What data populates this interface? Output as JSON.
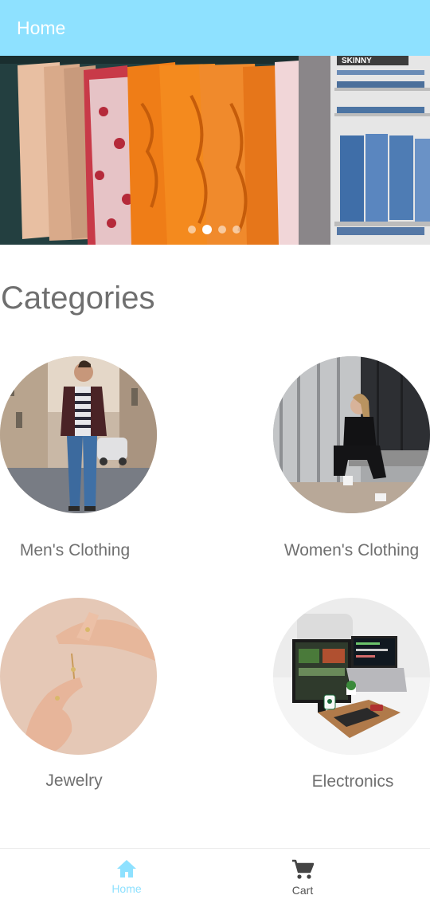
{
  "appbar": {
    "title": "Home"
  },
  "carousel": {
    "slides": [
      "clothing-rack-photo",
      "jeans-shelf-photo"
    ],
    "active_index": 1,
    "dot_count": 4
  },
  "categories": {
    "title": "Categories",
    "items": [
      {
        "label": "Men's Clothing",
        "image": "man-walking-photo"
      },
      {
        "label": "Women's Clothing",
        "image": "woman-sitting-photo"
      },
      {
        "label": "Jewelry",
        "image": "hands-ring-photo"
      },
      {
        "label": "Electronics",
        "image": "desk-computer-photo"
      }
    ]
  },
  "bottom_nav": {
    "items": [
      {
        "label": "Home",
        "icon": "home-icon",
        "active": true
      },
      {
        "label": "Cart",
        "icon": "cart-icon",
        "active": false
      }
    ],
    "active_color": "#8ee1ff",
    "inactive_color": "#555555"
  }
}
